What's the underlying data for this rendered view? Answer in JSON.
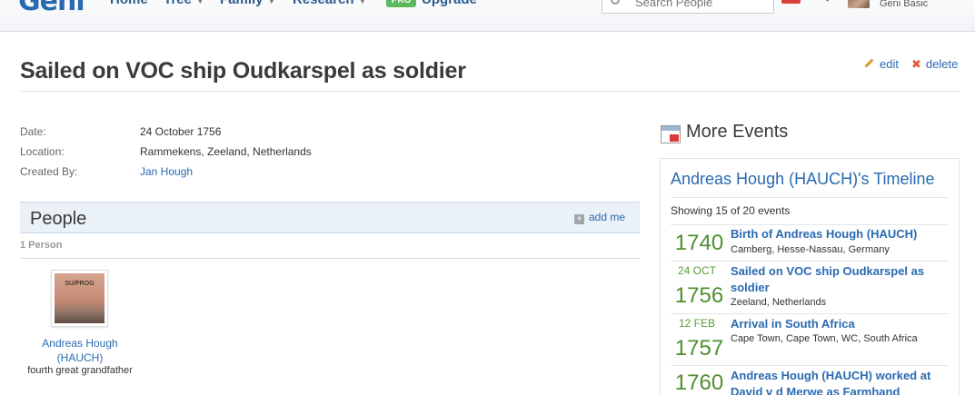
{
  "nav": {
    "logo": "Geni",
    "items": [
      {
        "label": "Home",
        "has_caret": false
      },
      {
        "label": "Tree",
        "has_caret": true
      },
      {
        "label": "Family",
        "has_caret": true
      },
      {
        "label": "Research",
        "has_caret": true
      }
    ],
    "pro_badge": "PRO",
    "upgrade": "Upgrade",
    "search_placeholder": "Search People",
    "account_label": "Geni Basic"
  },
  "page": {
    "title": "Sailed on VOC ship Oudkarspel as soldier",
    "edit_label": "edit",
    "delete_label": "delete"
  },
  "details": {
    "date_label": "Date:",
    "date_value": "24 October 1756",
    "location_label": "Location:",
    "location_value": "Rammekens, Zeeland, Netherlands",
    "created_label": "Created By:",
    "created_value": "Jan Hough"
  },
  "people": {
    "title": "People",
    "add_me": "add me",
    "count": "1 Person",
    "members": [
      {
        "photo_text": "SU/PROG",
        "name": "Andreas Hough (HAUCH)",
        "relation": "fourth great grandfather"
      }
    ]
  },
  "sidebar": {
    "title": "More Events",
    "timeline_title": "Andreas Hough (HAUCH)'s Timeline",
    "showing": "Showing 15 of 20 events",
    "events": [
      {
        "date": "",
        "year": "1740",
        "title": "Birth of Andreas Hough (HAUCH)",
        "place": "Camberg, Hesse-Nassau, Germany"
      },
      {
        "date": "24 OCT",
        "year": "1756",
        "title": "Sailed on VOC ship Oudkarspel as soldier",
        "place": "Zeeland, Netherlands"
      },
      {
        "date": "12 FEB",
        "year": "1757",
        "title": "Arrival in South Africa",
        "place": "Cape Town, Cape Town, WC, South Africa"
      },
      {
        "date": "",
        "year": "1760",
        "title": "Andreas Hough (HAUCH) worked at David v d Merwe as Farmhand",
        "place": ""
      }
    ]
  },
  "colors": {
    "link": "#2a6ab1",
    "year_green": "#4f8f2e",
    "pro_green": "#5cb85c",
    "header_bg": "#eaf1f7"
  }
}
